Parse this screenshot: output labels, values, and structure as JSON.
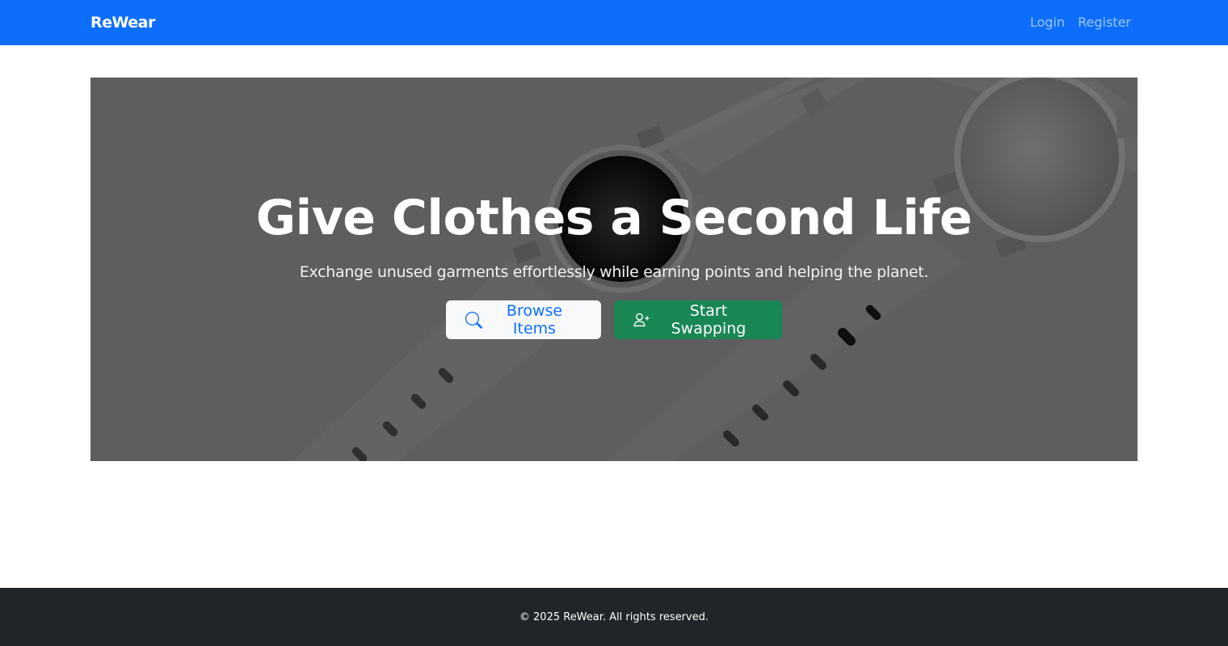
{
  "navbar": {
    "brand": "ReWear",
    "links": [
      {
        "label": "Login"
      },
      {
        "label": "Register"
      }
    ],
    "color": "#0d6efd"
  },
  "hero": {
    "title": "Give Clothes a Second Life",
    "subtitle": "Exchange unused garments effortlessly while earning points and helping the planet.",
    "buttons": {
      "browse": {
        "label": "Browse Items",
        "icon": "search-icon"
      },
      "swap": {
        "label": "Start Swapping",
        "icon": "person-plus-icon"
      }
    },
    "background_image": "smartwatches-image"
  },
  "footer": {
    "text": "© 2025 ReWear. All rights reserved."
  },
  "colors": {
    "primary": "#0d6efd",
    "success": "#198754",
    "dark": "#212529"
  }
}
